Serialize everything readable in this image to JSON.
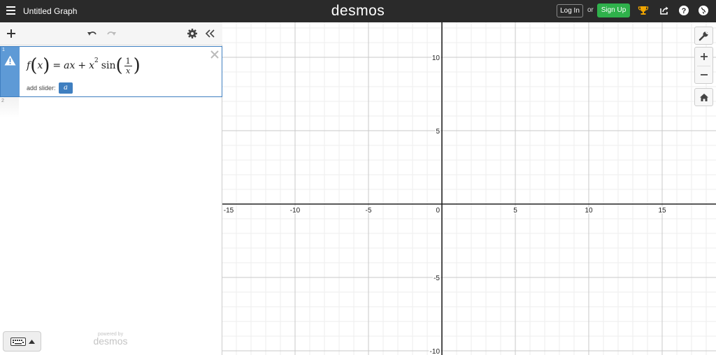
{
  "header": {
    "title": "Untitled Graph",
    "brand": "desmos",
    "login_label": "Log In",
    "or_label": "or",
    "signup_label": "Sign Up",
    "icons": [
      "menu-icon",
      "trophy-icon",
      "share-icon",
      "help-icon",
      "globe-icon"
    ]
  },
  "toolbar": {
    "icons": [
      "add-icon",
      "undo-icon",
      "redo-icon",
      "gear-icon",
      "collapse-icon"
    ]
  },
  "expressions": [
    {
      "index": "1",
      "status_icon": "warning-icon",
      "formula": {
        "f": "f",
        "x": "x",
        "rhs_a": "a",
        "rhs_x": "x",
        "plus": "+",
        "x2": "x",
        "exp": "2",
        "sin": "sin",
        "num": "1",
        "den": "x",
        "eq": "="
      },
      "add_slider_label": "add slider:",
      "slider_variable": "a"
    },
    {
      "index": "2",
      "formula": ""
    }
  ],
  "keypad": {
    "icon": "keyboard-icon"
  },
  "branding": {
    "small": "powered by",
    "big": "desmos"
  },
  "graph": {
    "x_ticks": [
      "-15",
      "-10",
      "-5",
      "0",
      "5",
      "10",
      "15"
    ],
    "y_ticks": [
      "10",
      "5",
      "-5",
      "-10"
    ],
    "axis_color": "#222222",
    "major_grid_color": "#c8c8c8",
    "minor_grid_color": "#eeeeee"
  },
  "controls": {
    "icons": [
      "wrench-icon",
      "zoom-in-icon",
      "zoom-out-icon",
      "home-icon"
    ]
  },
  "colors": {
    "accent": "#3f7fc0",
    "signup": "#2fb14b",
    "header": "#2a2a2a"
  }
}
